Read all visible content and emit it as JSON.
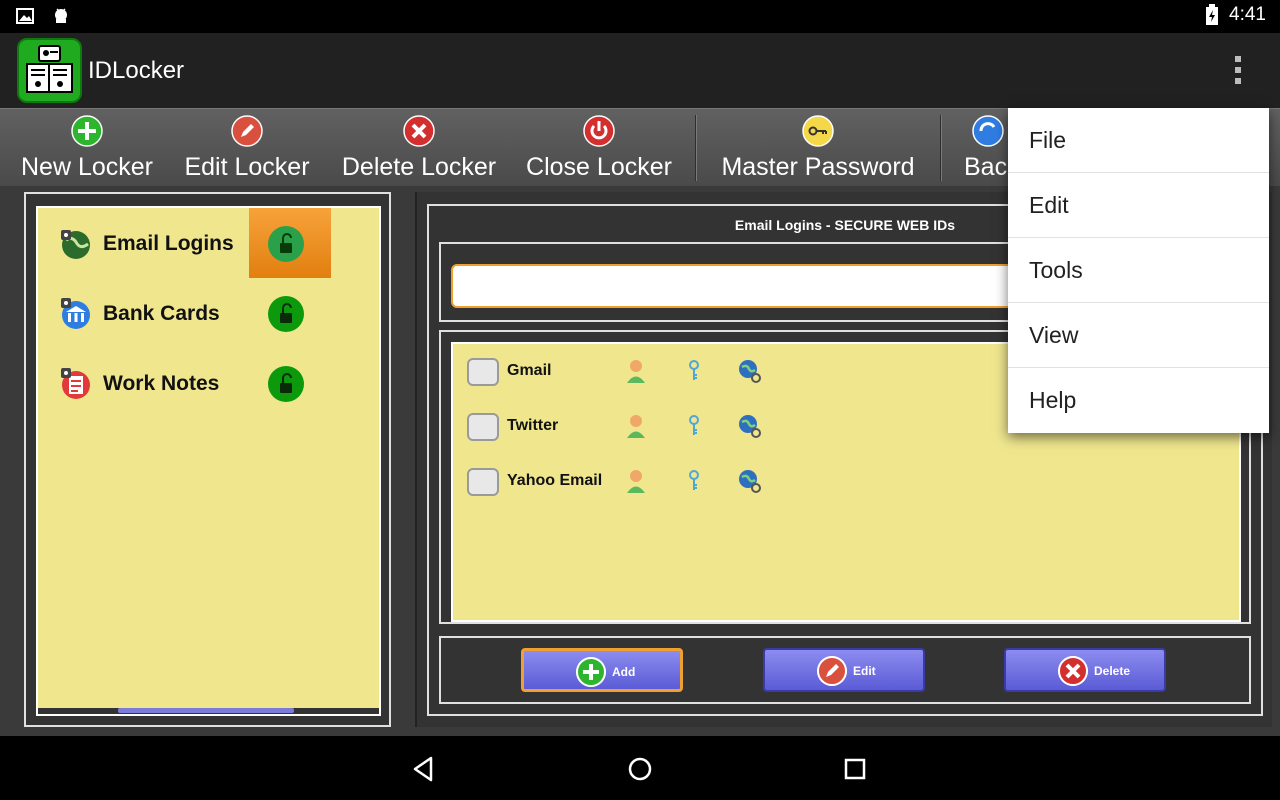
{
  "status_bar": {
    "time": "4:41"
  },
  "app": {
    "title": "IDLocker"
  },
  "toolbar": {
    "items": [
      {
        "label": "New Locker",
        "icon": "plus-icon",
        "color": "#2db52d"
      },
      {
        "label": "Edit Locker",
        "icon": "pencil-icon",
        "color": "#d9503f"
      },
      {
        "label": "Delete Locker",
        "icon": "x-icon",
        "color": "#d32f2f"
      },
      {
        "label": "Close Locker",
        "icon": "power-icon",
        "color": "#d32f2f"
      },
      {
        "label": "Master Password",
        "icon": "key-icon",
        "color": "#f5d74a"
      },
      {
        "label": "Bac",
        "icon": "backup-icon",
        "color": "#2f7de1"
      }
    ]
  },
  "lockers": [
    {
      "label": "Email Logins",
      "icon": "globe-lock-icon",
      "selected": true
    },
    {
      "label": "Bank Cards",
      "icon": "bank-lock-icon",
      "selected": false
    },
    {
      "label": "Work Notes",
      "icon": "notes-lock-icon",
      "selected": false
    }
  ],
  "detail": {
    "title": "Email Logins - SECURE WEB IDs",
    "search": {
      "value": "",
      "placeholder": ""
    },
    "entries": [
      {
        "label": "Gmail"
      },
      {
        "label": "Twitter"
      },
      {
        "label": "Yahoo Email"
      }
    ],
    "buttons": {
      "add": "Add",
      "edit": "Edit",
      "delete": "Delete"
    }
  },
  "menu": {
    "items": [
      "File",
      "Edit",
      "Tools",
      "View",
      "Help"
    ]
  },
  "colors": {
    "accent_orange": "#f0a030",
    "panel_yellow": "#efe68e",
    "button_blue": "#6f6fe0",
    "lock_green": "#0c9a0c"
  }
}
